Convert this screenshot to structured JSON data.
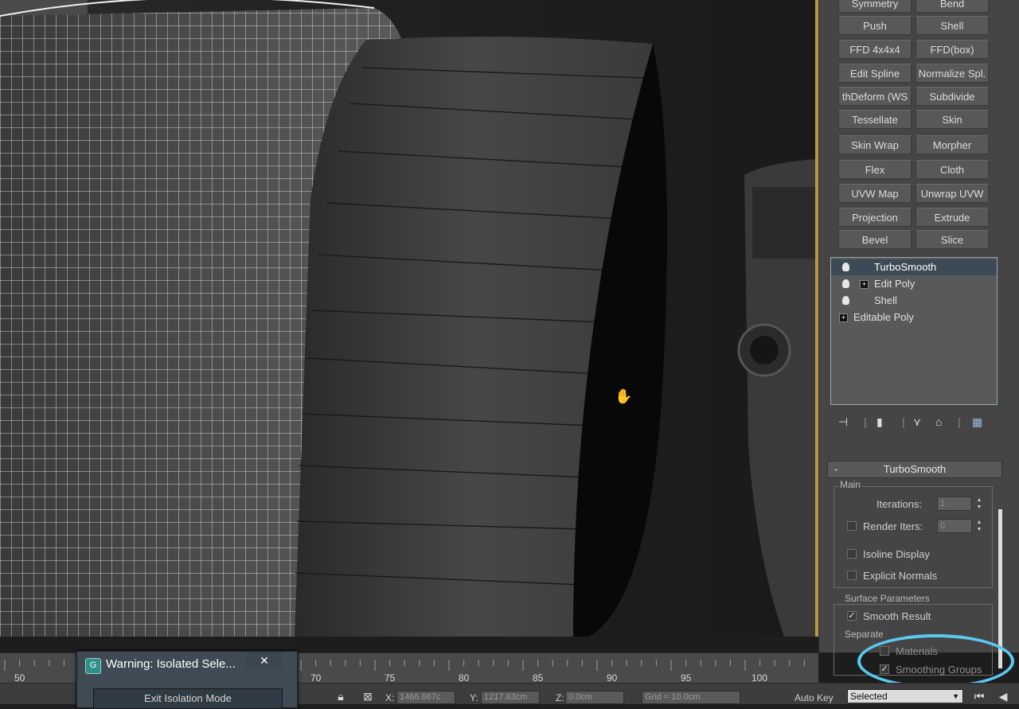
{
  "modifier_buttons": [
    [
      "Symmetry",
      "Bend"
    ],
    [
      "Push",
      "Shell"
    ],
    [
      "FFD 4x4x4",
      "FFD(box)"
    ],
    [
      "Edit Spline",
      "Normalize Spl."
    ],
    [
      "thDeform (WS",
      "Subdivide"
    ],
    [
      "Tessellate",
      "Skin"
    ],
    [
      "Skin Wrap",
      "Morpher"
    ],
    [
      "Flex",
      "Cloth"
    ],
    [
      "UVW Map",
      "Unwrap UVW"
    ],
    [
      "Projection",
      "Extrude"
    ],
    [
      "Bevel",
      "Slice"
    ]
  ],
  "modifier_stack": [
    {
      "label": "TurboSmooth",
      "selected": true,
      "bulb": true,
      "plus": false
    },
    {
      "label": "Edit Poly",
      "selected": false,
      "bulb": true,
      "plus": true
    },
    {
      "label": "Shell",
      "selected": false,
      "bulb": true,
      "plus": false
    },
    {
      "label": "Editable Poly",
      "selected": false,
      "bulb": false,
      "plus": true
    }
  ],
  "rollout": {
    "title": "TurboSmooth",
    "main_group": "Main",
    "iterations_label": "Iterations:",
    "iterations_value": "1",
    "render_iters_label": "Render Iters:",
    "render_iters_value": "0",
    "render_iters_checked": false,
    "isoline_label": "Isoline Display",
    "isoline_checked": false,
    "explicit_normals_label": "Explicit Normals",
    "explicit_normals_checked": false,
    "surface_group": "Surface Parameters",
    "smooth_result_label": "Smooth Result",
    "smooth_result_checked": true,
    "separate_label": "Separate",
    "materials_label": "Materials",
    "materials_checked": false,
    "smoothing_groups_label": "Smoothing Groups",
    "smoothing_groups_checked": true
  },
  "timeline": {
    "ticks": [
      "50",
      "70",
      "75",
      "80",
      "85",
      "90",
      "95",
      "100"
    ]
  },
  "dialog": {
    "title": "Warning: Isolated Sele...",
    "close": "✕",
    "button": "Exit Isolation Mode"
  },
  "status": {
    "x_label": "X:",
    "x_value": "1466.667c",
    "y_label": "Y:",
    "y_value": "1217.83cm",
    "z_label": "Z:",
    "z_value": "0.0cm",
    "grid": "Grid = 10.0cm",
    "autokey": "Auto Key",
    "selected": "Selected"
  },
  "colors": {
    "highlight": "#5ac8f0",
    "viewport_border": "#b89a3c"
  }
}
